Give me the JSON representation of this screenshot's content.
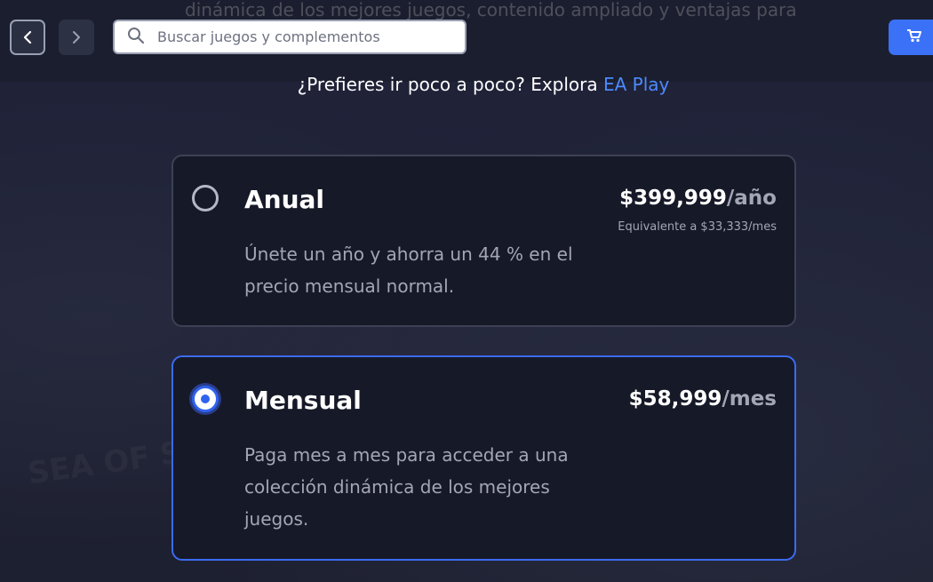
{
  "header": {
    "back_icon": "chevron-left-icon",
    "forward_icon": "chevron-right-icon",
    "search_placeholder": "Buscar juegos y complementos",
    "search_icon": "search-icon",
    "cart_icon": "cart-icon",
    "background_text": "dinámica de los mejores juegos, contenido ampliado y ventajas para miembros."
  },
  "explore": {
    "prefix": "¿Prefieres ir poco a poco? Explora ",
    "link": "EA Play"
  },
  "plans": [
    {
      "name": "Anual",
      "selected": false,
      "price": "$399,999",
      "unit": "/año",
      "equivalent": "Equivalente a $33,333/mes",
      "description": "Únete un año y ahorra un 44 % en el precio mensual normal."
    },
    {
      "name": "Mensual",
      "selected": true,
      "price": "$58,999",
      "unit": "/mes",
      "description": "Paga mes a mes para acceder a una colección dinámica de los mejores juegos."
    }
  ],
  "background": {
    "ghost_text": "SEA OF SOLITUDE"
  },
  "colors": {
    "accent": "#3b71f7",
    "link": "#4a8aff",
    "background": "#1f2232",
    "card": "#161927",
    "muted_text": "#a3a6b4"
  }
}
